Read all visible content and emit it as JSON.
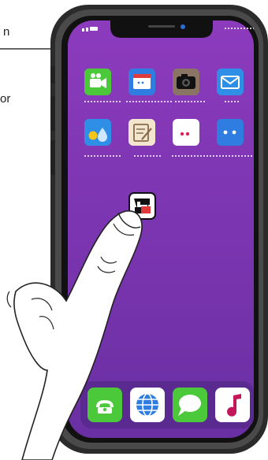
{
  "side_text": {
    "fragment_1": "n",
    "fragment_2": "or"
  },
  "home_screen": {
    "app_rows": [
      [
        {
          "icon": "video-camera-icon",
          "color": "#4cc93a"
        },
        {
          "icon": "calendar-icon",
          "color": "#2f7de1"
        },
        {
          "icon": "camera-icon",
          "color": "#6b5a4e"
        },
        {
          "icon": "mail-icon",
          "color": "#2f8fe6"
        }
      ],
      [
        {
          "icon": "weather-icon",
          "color": "#2f8fe6"
        },
        {
          "icon": "notes-icon",
          "color": "#f3e6cf"
        },
        {
          "icon": "dots-app-icon",
          "color": "#ffffff"
        },
        {
          "icon": "dots-app-icon",
          "color": "#2f7de1"
        }
      ]
    ],
    "highlighted_app": {
      "icon": "app-icon"
    },
    "dock": [
      {
        "icon": "phone-icon",
        "color": "#4cc93a"
      },
      {
        "icon": "globe-icon",
        "color": "#2f7de1"
      },
      {
        "icon": "messages-icon",
        "color": "#4cc93a"
      },
      {
        "icon": "music-icon",
        "color": "#ffffff"
      }
    ]
  },
  "colors": {
    "wallpaper_top": "#8c3bbd",
    "wallpaper_bottom": "#6a2fa3",
    "frame": "#3a3a3a"
  }
}
